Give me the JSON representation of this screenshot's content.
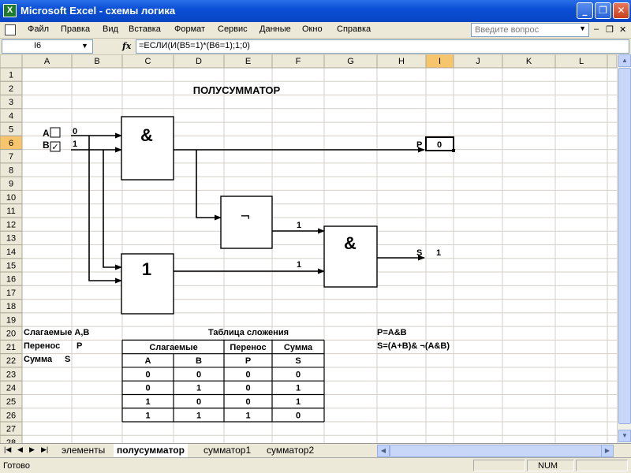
{
  "window": {
    "title": "Microsoft Excel - схемы логика",
    "app_icon": "X"
  },
  "menu": [
    "Файл",
    "Правка",
    "Вид",
    "Вставка",
    "Формат",
    "Сервис",
    "Данные",
    "Окно",
    "Справка"
  ],
  "help_placeholder": "Введите вопрос",
  "formula_bar": {
    "cell": "I6",
    "formula": "=ЕСЛИ(И(B5=1)*(B6=1);1;0)",
    "fx": "fx"
  },
  "columns": [
    "A",
    "B",
    "C",
    "D",
    "E",
    "F",
    "G",
    "H",
    "I",
    "J",
    "K",
    "L"
  ],
  "rows": [
    "1",
    "2",
    "3",
    "4",
    "5",
    "6",
    "7",
    "8",
    "9",
    "10",
    "11",
    "12",
    "13",
    "14",
    "15",
    "16",
    "17",
    "18",
    "19",
    "20",
    "21",
    "22",
    "23",
    "24",
    "25",
    "26",
    "27",
    "28"
  ],
  "selected": {
    "column": "I",
    "row": "6"
  },
  "sheet": {
    "title": "ПОЛУСУММАТОР",
    "input_a_label": "A",
    "input_b_label": "B",
    "input_a_value": "0",
    "input_b_value": "1",
    "and_gate_symbol": "&",
    "or_gate_symbol": "1",
    "not_gate_symbol": "¬",
    "and2_gate_symbol": "&",
    "not_out_value": "1",
    "or_out_value": "1",
    "p_label": "P",
    "p_value": "0",
    "s_label": "S",
    "s_value": "1",
    "legend_1": "Слагаемые А,В",
    "legend_2_label": "Перенос",
    "legend_2_value": "P",
    "legend_3_label": "Сумма",
    "legend_3_value": "S",
    "table_title": "Таблица сложения",
    "table_h_addends": "Слагаемые",
    "table_h_carry": "Перенос",
    "table_h_sum": "Сумма",
    "table_sub": [
      "A",
      "B",
      "P",
      "S"
    ],
    "table_rows": [
      [
        "0",
        "0",
        "0",
        "0"
      ],
      [
        "0",
        "1",
        "0",
        "1"
      ],
      [
        "1",
        "0",
        "0",
        "1"
      ],
      [
        "1",
        "1",
        "1",
        "0"
      ]
    ],
    "formula_p": "P=A&B",
    "formula_s": "S=(A+B)& ¬(A&B)"
  },
  "tabs": [
    "элементы",
    "полусумматор",
    "сумматор1",
    "сумматор2"
  ],
  "active_tab": "полусумматор",
  "status": {
    "text": "Готово",
    "num": "NUM"
  }
}
